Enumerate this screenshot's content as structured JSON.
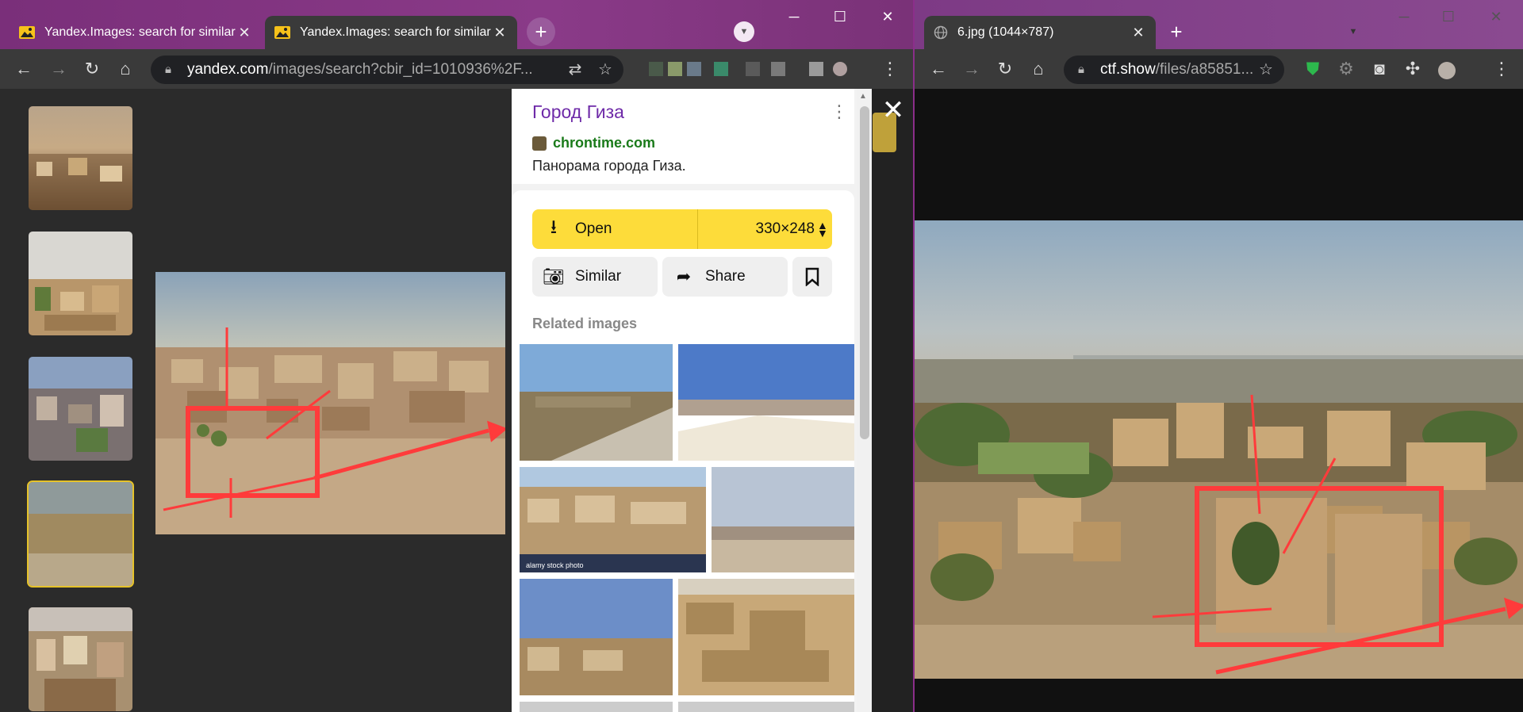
{
  "left_window": {
    "tabs": [
      {
        "title": "Yandex.Images: search for similar",
        "active": false
      },
      {
        "title": "Yandex.Images: search for similar",
        "active": true
      }
    ],
    "new_tab": "+",
    "url": {
      "host": "yandex.com",
      "path": "/images/search?cbir_id=1010936%2F..."
    },
    "window_controls": {
      "minimize": "─",
      "maximize": "☐",
      "close": "✕"
    },
    "panel": {
      "site_title": "Город Гиза",
      "domain": "chrontime.com",
      "description": "Панорама города Гиза.",
      "open_label": "Open",
      "size_label": "330×248",
      "similar_label": "Similar",
      "share_label": "Share",
      "related_heading": "Related images",
      "stock_watermark": "alamy stock photo"
    },
    "close_viewer": "✕"
  },
  "right_window": {
    "tabs": [
      {
        "title": "6.jpg (1044×787)",
        "active": true
      }
    ],
    "new_tab": "+",
    "url": {
      "host": "ctf.show",
      "path": "/files/a85851..."
    },
    "window_controls": {
      "minimize": "─",
      "maximize": "☐",
      "close": "✕"
    }
  },
  "colors": {
    "accent_yellow": "#fddc3a",
    "site_title_purple": "#6e2aa8",
    "domain_green": "#1a7a1a",
    "annotation_red": "#ff3b3b"
  }
}
